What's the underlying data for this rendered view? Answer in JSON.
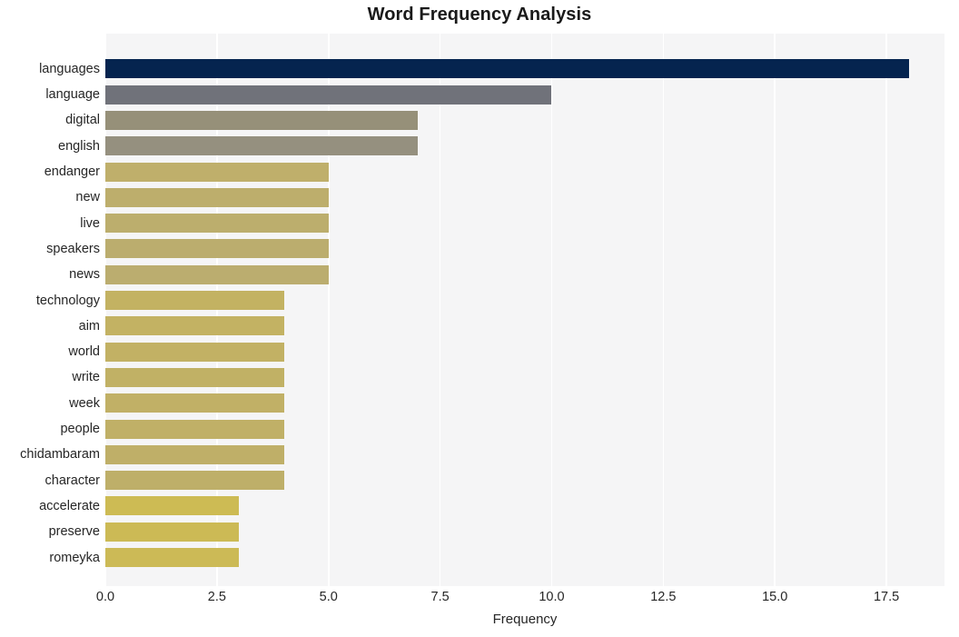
{
  "chart_data": {
    "type": "bar",
    "orientation": "horizontal",
    "title": "Word Frequency Analysis",
    "xlabel": "Frequency",
    "ylabel": "",
    "xlim": [
      0,
      18.8
    ],
    "xticks": [
      "0.0",
      "2.5",
      "5.0",
      "7.5",
      "10.0",
      "12.5",
      "15.0",
      "17.5"
    ],
    "xtick_values": [
      0,
      2.5,
      5,
      7.5,
      10,
      12.5,
      15,
      17.5
    ],
    "grid": "vertical-white-on-light-gray",
    "legend": "none",
    "categories": [
      "languages",
      "language",
      "digital",
      "english",
      "endanger",
      "new",
      "live",
      "speakers",
      "news",
      "technology",
      "aim",
      "world",
      "write",
      "week",
      "people",
      "chidambaram",
      "character",
      "accelerate",
      "preserve",
      "romeyka"
    ],
    "values": [
      18,
      10,
      7,
      7,
      5,
      5,
      5,
      5,
      5,
      4,
      4,
      4,
      4,
      4,
      4,
      4,
      4,
      3,
      3,
      3
    ],
    "bar_colors": [
      "#05244f",
      "#70727a",
      "#969079",
      "#95907f",
      "#bfaf6b",
      "#bdae6c",
      "#bcae6d",
      "#bbad6e",
      "#bbad6f",
      "#c3b262",
      "#c3b263",
      "#c2b164",
      "#c1b165",
      "#c1b066",
      "#c0b067",
      "#bfaf68",
      "#beaf69",
      "#cdbb54",
      "#ccba55",
      "#ccba56"
    ],
    "background_color": "#f5f5f6",
    "figure_background": "#ffffff",
    "text_color": "#262626"
  }
}
